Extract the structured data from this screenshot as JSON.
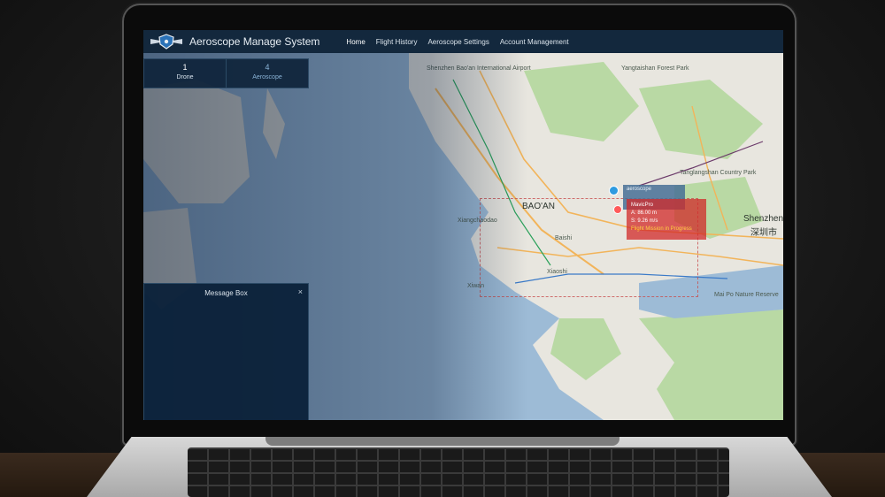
{
  "app": {
    "title": "Aeroscope Manage System"
  },
  "nav": {
    "items": [
      {
        "label": "Home",
        "active": true
      },
      {
        "label": "Flight History"
      },
      {
        "label": "Aeroscope Settings"
      },
      {
        "label": "Account Management"
      }
    ]
  },
  "stats": {
    "drone": {
      "count": "1",
      "label": "Drone"
    },
    "aeroscope": {
      "count": "4",
      "label": "Aeroscope"
    }
  },
  "message_box": {
    "title": "Message Box",
    "close": "×"
  },
  "popups": {
    "aeroscope_label": "aeroscope",
    "drone": {
      "model": "MavicPro",
      "altitude": "A: 86.00 m",
      "speed": "S: 9.26 m/s",
      "warning": "Flight Mission in Progress"
    }
  },
  "map_labels": {
    "airport": "Shenzhen Bao'an International Airport",
    "baoan": "BAO'AN",
    "xixiang": "Xiangchaodao",
    "shenzhen": "Shenzhen",
    "shenzhen_cn": "深圳市",
    "xiaoshi": "Xiaoshi",
    "nanshan": "Baishi",
    "gaofeng": "Yangtaishan Forest Park",
    "tanglang": "Tanglangshan Country Park",
    "maipo": "Mai Po Nature Reserve",
    "xiwan": "Xiwan"
  },
  "colors": {
    "navbar": "#13283d",
    "panel": "#0e233a",
    "sea": "#9dbbd6",
    "land": "#e8e6df",
    "park": "#b9d9a4",
    "warning": "#ffd23f",
    "drone_popup": "#d22828"
  }
}
